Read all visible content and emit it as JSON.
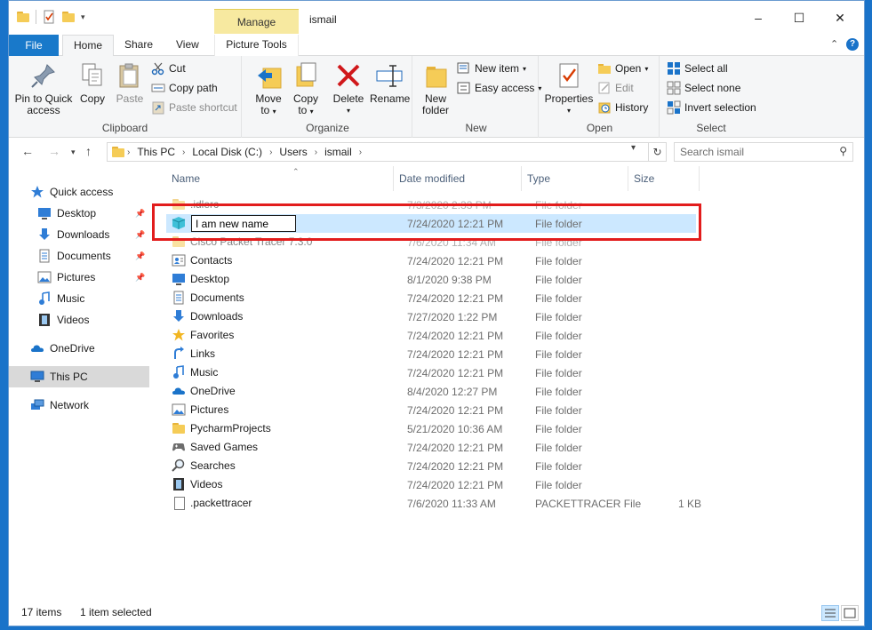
{
  "window": {
    "title": "ismail",
    "context_tab": "Manage",
    "minimize": "–",
    "maximize": "☐",
    "close": "✕"
  },
  "ribbon_tabs": {
    "file": "File",
    "home": "Home",
    "share": "Share",
    "view": "View",
    "picture_tools": "Picture Tools"
  },
  "ribbon": {
    "clipboard": {
      "label": "Clipboard",
      "pin_line1": "Pin to Quick",
      "pin_line2": "access",
      "copy": "Copy",
      "paste": "Paste",
      "cut": "Cut",
      "copy_path": "Copy path",
      "paste_shortcut": "Paste shortcut"
    },
    "organize": {
      "label": "Organize",
      "move_line1": "Move",
      "move_line2": "to",
      "copy_line1": "Copy",
      "copy_line2": "to",
      "delete": "Delete",
      "rename": "Rename"
    },
    "new": {
      "label": "New",
      "new_folder_line1": "New",
      "new_folder_line2": "folder",
      "new_item": "New item",
      "easy_access": "Easy access"
    },
    "open": {
      "label": "Open",
      "properties": "Properties",
      "open": "Open",
      "edit": "Edit",
      "history": "History"
    },
    "select": {
      "label": "Select",
      "select_all": "Select all",
      "select_none": "Select none",
      "invert": "Invert selection"
    }
  },
  "address": {
    "segments": [
      "This PC",
      "Local Disk (C:)",
      "Users",
      "ismail"
    ],
    "search_placeholder": "Search ismail"
  },
  "nav": {
    "quick_access": "Quick access",
    "desktop": "Desktop",
    "downloads": "Downloads",
    "documents": "Documents",
    "pictures": "Pictures",
    "music": "Music",
    "videos": "Videos",
    "onedrive": "OneDrive",
    "this_pc": "This PC",
    "network": "Network"
  },
  "columns": {
    "name": "Name",
    "date": "Date modified",
    "type": "Type",
    "size": "Size"
  },
  "rename_value": "I am new name",
  "files": [
    {
      "name": ".idlerc",
      "date": "7/3/2020 2:33 PM",
      "type": "File folder",
      "size": "",
      "icon": "folder-icon"
    },
    {
      "name": "I am new name",
      "date": "7/24/2020 12:21 PM",
      "type": "File folder",
      "size": "",
      "icon": "3d-objects-icon"
    },
    {
      "name": "Cisco Packet Tracer 7.3.0",
      "date": "7/6/2020 11:34 AM",
      "type": "File folder",
      "size": "",
      "icon": "folder-icon"
    },
    {
      "name": "Contacts",
      "date": "7/24/2020 12:21 PM",
      "type": "File folder",
      "size": "",
      "icon": "contacts-icon"
    },
    {
      "name": "Desktop",
      "date": "8/1/2020 9:38 PM",
      "type": "File folder",
      "size": "",
      "icon": "desktop-icon"
    },
    {
      "name": "Documents",
      "date": "7/24/2020 12:21 PM",
      "type": "File folder",
      "size": "",
      "icon": "documents-icon"
    },
    {
      "name": "Downloads",
      "date": "7/27/2020 1:22 PM",
      "type": "File folder",
      "size": "",
      "icon": "downloads-icon"
    },
    {
      "name": "Favorites",
      "date": "7/24/2020 12:21 PM",
      "type": "File folder",
      "size": "",
      "icon": "favorites-icon"
    },
    {
      "name": "Links",
      "date": "7/24/2020 12:21 PM",
      "type": "File folder",
      "size": "",
      "icon": "links-icon"
    },
    {
      "name": "Music",
      "date": "7/24/2020 12:21 PM",
      "type": "File folder",
      "size": "",
      "icon": "music-icon"
    },
    {
      "name": "OneDrive",
      "date": "8/4/2020 12:27 PM",
      "type": "File folder",
      "size": "",
      "icon": "onedrive-icon"
    },
    {
      "name": "Pictures",
      "date": "7/24/2020 12:21 PM",
      "type": "File folder",
      "size": "",
      "icon": "pictures-icon"
    },
    {
      "name": "PycharmProjects",
      "date": "5/21/2020 10:36 AM",
      "type": "File folder",
      "size": "",
      "icon": "folder-icon"
    },
    {
      "name": "Saved Games",
      "date": "7/24/2020 12:21 PM",
      "type": "File folder",
      "size": "",
      "icon": "saved-games-icon"
    },
    {
      "name": "Searches",
      "date": "7/24/2020 12:21 PM",
      "type": "File folder",
      "size": "",
      "icon": "searches-icon"
    },
    {
      "name": "Videos",
      "date": "7/24/2020 12:21 PM",
      "type": "File folder",
      "size": "",
      "icon": "videos-icon"
    },
    {
      "name": ".packettracer",
      "date": "7/6/2020 11:33 AM",
      "type": "PACKETTRACER File",
      "size": "1 KB",
      "icon": "file-icon"
    }
  ],
  "status": {
    "count": "17 items",
    "selected": "1 item selected"
  },
  "colors": {
    "accent": "#1979ca",
    "selection": "#cce8ff",
    "highlight_box": "#e21c1c",
    "manage_tab": "#f7e9a0"
  }
}
